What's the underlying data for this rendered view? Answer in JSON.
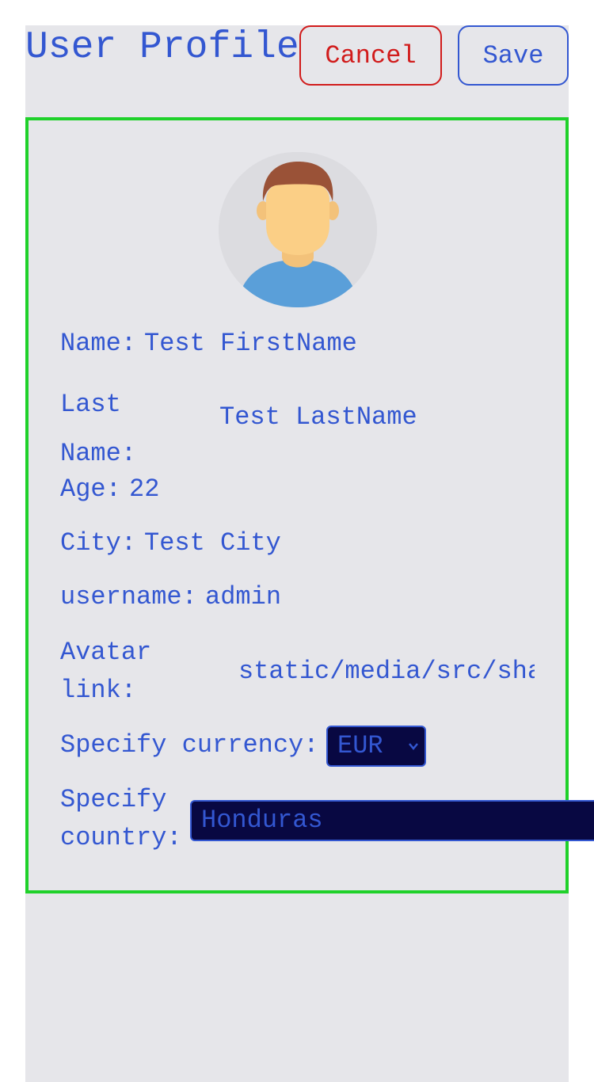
{
  "header": {
    "title": "User Profile",
    "cancel_label": "Cancel",
    "save_label": "Save"
  },
  "profile": {
    "name_label": "Name:",
    "name_value": "Test FirstName",
    "last_name_label": "Last Name:",
    "last_name_value": "Test LastName",
    "age_label": "Age:",
    "age_value": "22",
    "city_label": "City:",
    "city_value": "Test City",
    "username_label": "username:",
    "username_value": "admin",
    "avatar_link_label": "Avatar link:",
    "avatar_link_value": "static/media/src/sha",
    "currency_label": "Specify currency:",
    "currency_value": "EUR",
    "country_label": "Specify country:",
    "country_value": "Honduras"
  },
  "colors": {
    "accent": "#3357d1",
    "cancel": "#d11b1b",
    "card_border": "#1fd12a",
    "background": "#e6e6ea",
    "input_bg": "#080842"
  },
  "icons": {
    "avatar": "user-avatar-icon",
    "dropdown": "chevron-down-icon"
  }
}
